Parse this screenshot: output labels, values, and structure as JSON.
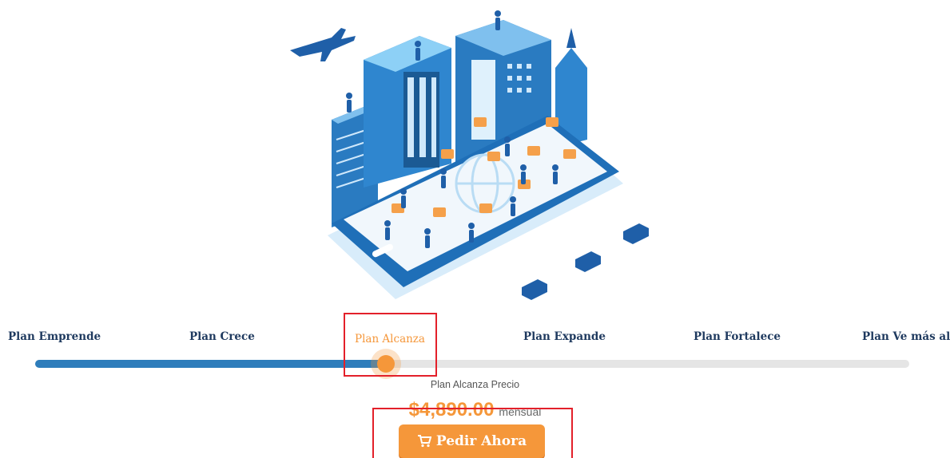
{
  "plans": [
    {
      "label": "Plan Emprende",
      "active": false
    },
    {
      "label": "Plan Crece",
      "active": false
    },
    {
      "label": "Plan Alcanza",
      "active": true
    },
    {
      "label": "Plan Expande",
      "active": false
    },
    {
      "label": "Plan Fortalece",
      "active": false
    },
    {
      "label": "Plan Ve más allá",
      "active": false
    }
  ],
  "slider": {
    "selected_index": 2,
    "total_steps": 6
  },
  "price": {
    "label": "Plan Alcanza Precio",
    "amount": "$4,890.00",
    "unit": "mensual"
  },
  "order_button": {
    "label": "Pedir Ahora",
    "icon": "cart-icon"
  },
  "colors": {
    "accent": "#f5973a",
    "navy": "#1f3a5f",
    "blue": "#2e7dbb",
    "highlight": "#e3202a"
  },
  "illustration": {
    "name": "smart-city-phone-illustration"
  }
}
